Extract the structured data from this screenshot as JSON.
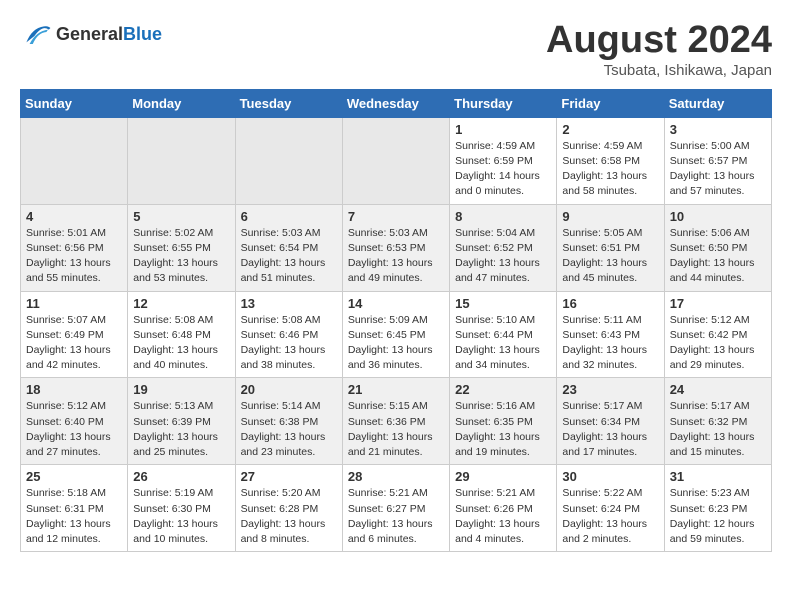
{
  "header": {
    "logo_general": "General",
    "logo_blue": "Blue",
    "main_title": "August 2024",
    "subtitle": "Tsubata, Ishikawa, Japan"
  },
  "calendar": {
    "headers": [
      "Sunday",
      "Monday",
      "Tuesday",
      "Wednesday",
      "Thursday",
      "Friday",
      "Saturday"
    ],
    "rows": [
      {
        "bg": "white",
        "cells": [
          {
            "empty": true
          },
          {
            "empty": true
          },
          {
            "empty": true
          },
          {
            "empty": true
          },
          {
            "day": "1",
            "info": "Sunrise: 4:59 AM\nSunset: 6:59 PM\nDaylight: 14 hours\nand 0 minutes."
          },
          {
            "day": "2",
            "info": "Sunrise: 4:59 AM\nSunset: 6:58 PM\nDaylight: 13 hours\nand 58 minutes."
          },
          {
            "day": "3",
            "info": "Sunrise: 5:00 AM\nSunset: 6:57 PM\nDaylight: 13 hours\nand 57 minutes."
          }
        ]
      },
      {
        "bg": "gray",
        "cells": [
          {
            "day": "4",
            "info": "Sunrise: 5:01 AM\nSunset: 6:56 PM\nDaylight: 13 hours\nand 55 minutes."
          },
          {
            "day": "5",
            "info": "Sunrise: 5:02 AM\nSunset: 6:55 PM\nDaylight: 13 hours\nand 53 minutes."
          },
          {
            "day": "6",
            "info": "Sunrise: 5:03 AM\nSunset: 6:54 PM\nDaylight: 13 hours\nand 51 minutes."
          },
          {
            "day": "7",
            "info": "Sunrise: 5:03 AM\nSunset: 6:53 PM\nDaylight: 13 hours\nand 49 minutes."
          },
          {
            "day": "8",
            "info": "Sunrise: 5:04 AM\nSunset: 6:52 PM\nDaylight: 13 hours\nand 47 minutes."
          },
          {
            "day": "9",
            "info": "Sunrise: 5:05 AM\nSunset: 6:51 PM\nDaylight: 13 hours\nand 45 minutes."
          },
          {
            "day": "10",
            "info": "Sunrise: 5:06 AM\nSunset: 6:50 PM\nDaylight: 13 hours\nand 44 minutes."
          }
        ]
      },
      {
        "bg": "white",
        "cells": [
          {
            "day": "11",
            "info": "Sunrise: 5:07 AM\nSunset: 6:49 PM\nDaylight: 13 hours\nand 42 minutes."
          },
          {
            "day": "12",
            "info": "Sunrise: 5:08 AM\nSunset: 6:48 PM\nDaylight: 13 hours\nand 40 minutes."
          },
          {
            "day": "13",
            "info": "Sunrise: 5:08 AM\nSunset: 6:46 PM\nDaylight: 13 hours\nand 38 minutes."
          },
          {
            "day": "14",
            "info": "Sunrise: 5:09 AM\nSunset: 6:45 PM\nDaylight: 13 hours\nand 36 minutes."
          },
          {
            "day": "15",
            "info": "Sunrise: 5:10 AM\nSunset: 6:44 PM\nDaylight: 13 hours\nand 34 minutes."
          },
          {
            "day": "16",
            "info": "Sunrise: 5:11 AM\nSunset: 6:43 PM\nDaylight: 13 hours\nand 32 minutes."
          },
          {
            "day": "17",
            "info": "Sunrise: 5:12 AM\nSunset: 6:42 PM\nDaylight: 13 hours\nand 29 minutes."
          }
        ]
      },
      {
        "bg": "gray",
        "cells": [
          {
            "day": "18",
            "info": "Sunrise: 5:12 AM\nSunset: 6:40 PM\nDaylight: 13 hours\nand 27 minutes."
          },
          {
            "day": "19",
            "info": "Sunrise: 5:13 AM\nSunset: 6:39 PM\nDaylight: 13 hours\nand 25 minutes."
          },
          {
            "day": "20",
            "info": "Sunrise: 5:14 AM\nSunset: 6:38 PM\nDaylight: 13 hours\nand 23 minutes."
          },
          {
            "day": "21",
            "info": "Sunrise: 5:15 AM\nSunset: 6:36 PM\nDaylight: 13 hours\nand 21 minutes."
          },
          {
            "day": "22",
            "info": "Sunrise: 5:16 AM\nSunset: 6:35 PM\nDaylight: 13 hours\nand 19 minutes."
          },
          {
            "day": "23",
            "info": "Sunrise: 5:17 AM\nSunset: 6:34 PM\nDaylight: 13 hours\nand 17 minutes."
          },
          {
            "day": "24",
            "info": "Sunrise: 5:17 AM\nSunset: 6:32 PM\nDaylight: 13 hours\nand 15 minutes."
          }
        ]
      },
      {
        "bg": "white",
        "cells": [
          {
            "day": "25",
            "info": "Sunrise: 5:18 AM\nSunset: 6:31 PM\nDaylight: 13 hours\nand 12 minutes."
          },
          {
            "day": "26",
            "info": "Sunrise: 5:19 AM\nSunset: 6:30 PM\nDaylight: 13 hours\nand 10 minutes."
          },
          {
            "day": "27",
            "info": "Sunrise: 5:20 AM\nSunset: 6:28 PM\nDaylight: 13 hours\nand 8 minutes."
          },
          {
            "day": "28",
            "info": "Sunrise: 5:21 AM\nSunset: 6:27 PM\nDaylight: 13 hours\nand 6 minutes."
          },
          {
            "day": "29",
            "info": "Sunrise: 5:21 AM\nSunset: 6:26 PM\nDaylight: 13 hours\nand 4 minutes."
          },
          {
            "day": "30",
            "info": "Sunrise: 5:22 AM\nSunset: 6:24 PM\nDaylight: 13 hours\nand 2 minutes."
          },
          {
            "day": "31",
            "info": "Sunrise: 5:23 AM\nSunset: 6:23 PM\nDaylight: 12 hours\nand 59 minutes."
          }
        ]
      }
    ]
  }
}
